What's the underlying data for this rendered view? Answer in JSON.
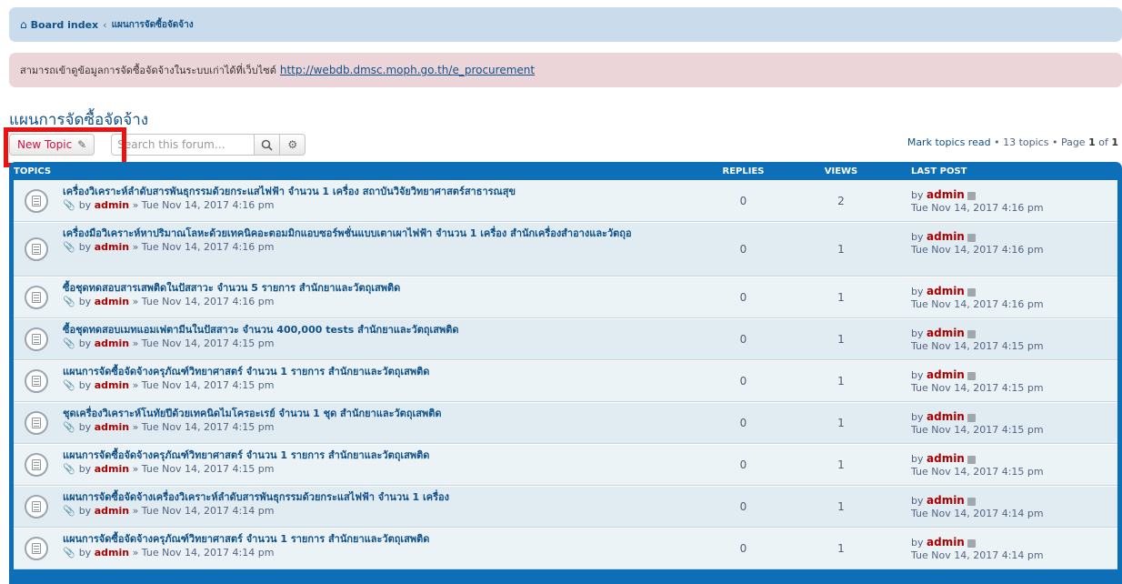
{
  "breadcrumb": {
    "home": "Board index",
    "separator": "‹",
    "forum": "แผนการจัดซื้อจัดจ้าง"
  },
  "notice": {
    "text": "สามารถเข้าดูข้อมูลการจัดซื้อจัดจ้างในระบบเก่าได้ที่เว็บไซต์",
    "link": "http://webdb.dmsc.moph.go.th/e_procurement"
  },
  "forum_title": "แผนการจัดซื้อจัดจ้าง",
  "actions": {
    "new_topic": "New Topic",
    "search_placeholder": "Search this forum…"
  },
  "pagination": {
    "mark_read": "Mark topics read",
    "bullet": "•",
    "topic_count": "13 topics",
    "page_label": "Page",
    "page": "1",
    "of": "of",
    "total_pages": "1"
  },
  "table": {
    "headers": {
      "topics": "Topics",
      "replies": "Replies",
      "views": "Views",
      "last_post": "Last post"
    },
    "topics": [
      {
        "title": "เครื่องวิเคราะห์ลำดับสารพันธุกรรมด้วยกระแสไฟฟ้า จำนวน 1 เครื่อง สถาบันวิจัยวิทยาศาสตร์สาธารณสุข",
        "by": "by",
        "author": "admin",
        "date": "» Tue Nov 14, 2017 4:16 pm",
        "replies": "0",
        "views": "2",
        "last_by": "by",
        "last_author": "admin",
        "last_date": "Tue Nov 14, 2017 4:16 pm"
      },
      {
        "title": "เครื่องมือวิเคราะห์หาปริมาณโลหะด้วยเทคนิคอะตอมมิกแอบซอร์พชั่นแบบเตาเผาไฟฟ้า จำนวน 1 เครื่อง สำนักเครื่องสำอางและวัตถุอ",
        "by": "by",
        "author": "admin",
        "date": "» Tue Nov 14, 2017 4:16 pm",
        "replies": "0",
        "views": "1",
        "last_by": "by",
        "last_author": "admin",
        "last_date": "Tue Nov 14, 2017 4:16 pm"
      },
      {
        "title": "ซื้อชุดทดสอบสารเสพติดในปัสสาวะ จำนวน 5 รายการ สำนักยาและวัตถุเสพติด",
        "by": "by",
        "author": "admin",
        "date": "» Tue Nov 14, 2017 4:16 pm",
        "replies": "0",
        "views": "1",
        "last_by": "by",
        "last_author": "admin",
        "last_date": "Tue Nov 14, 2017 4:16 pm"
      },
      {
        "title": "ซื้อชุดทดสอบเมทแอมเฟตามีนในปัสสาวะ จำนวน 400,000 tests สำนักยาและวัตถุเสพติด",
        "by": "by",
        "author": "admin",
        "date": "» Tue Nov 14, 2017 4:15 pm",
        "replies": "0",
        "views": "1",
        "last_by": "by",
        "last_author": "admin",
        "last_date": "Tue Nov 14, 2017 4:15 pm"
      },
      {
        "title": "แผนการจัดซื้อจัดจ้างครุภัณฑ์วิทยาศาสตร์ จำนวน 1 รายการ สำนักยาและวัตถุเสพติด",
        "by": "by",
        "author": "admin",
        "date": "» Tue Nov 14, 2017 4:15 pm",
        "replies": "0",
        "views": "1",
        "last_by": "by",
        "last_author": "admin",
        "last_date": "Tue Nov 14, 2017 4:15 pm"
      },
      {
        "title": "ชุดเครื่องวิเคราะห์โนทัยปีด้วยเทคนิดไมโครอะเรย์ จำนวน 1 ชุด สำนักยาและวัตถุเสพติด",
        "by": "by",
        "author": "admin",
        "date": "» Tue Nov 14, 2017 4:15 pm",
        "replies": "0",
        "views": "1",
        "last_by": "by",
        "last_author": "admin",
        "last_date": "Tue Nov 14, 2017 4:15 pm"
      },
      {
        "title": "แผนการจัดซื้อจัดจ้างครุภัณฑ์วิทยาศาสตร์ จำนวน 1 รายการ สำนักยาและวัตถุเสพติด",
        "by": "by",
        "author": "admin",
        "date": "» Tue Nov 14, 2017 4:15 pm",
        "replies": "0",
        "views": "1",
        "last_by": "by",
        "last_author": "admin",
        "last_date": "Tue Nov 14, 2017 4:15 pm"
      },
      {
        "title": "แผนการจัดซื้อจัดจ้างเครื่องวิเคราะห์ลำดับสารพันธุกรรมด้วยกระแสไฟฟ้า จำนวน 1 เครื่อง",
        "by": "by",
        "author": "admin",
        "date": "» Tue Nov 14, 2017 4:14 pm",
        "replies": "0",
        "views": "1",
        "last_by": "by",
        "last_author": "admin",
        "last_date": "Tue Nov 14, 2017 4:14 pm"
      },
      {
        "title": "แผนการจัดซื้อจัดจ้างครุภัณฑ์วิทยาศาสตร์ จำนวน 1 รายการ สำนักยาและวัตถุเสพติด",
        "by": "by",
        "author": "admin",
        "date": "» Tue Nov 14, 2017 4:14 pm",
        "replies": "0",
        "views": "1",
        "last_by": "by",
        "last_author": "admin",
        "last_date": "Tue Nov 14, 2017 4:14 pm"
      }
    ]
  },
  "colors": {
    "header_blue": "#0d6fb8",
    "link_blue": "#105289",
    "author_red": "#aa0000",
    "new_topic_red": "#d31141",
    "highlight_red": "#ee1111"
  }
}
